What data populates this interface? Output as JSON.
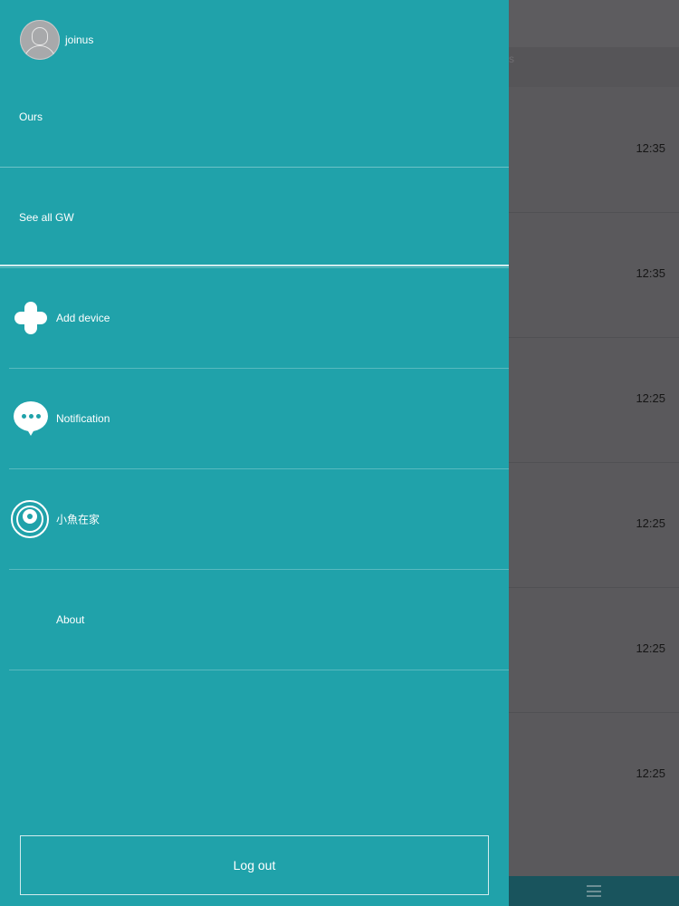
{
  "background": {
    "subbar_text": "s",
    "rows": [
      {
        "time": "12:35"
      },
      {
        "time": "12:35"
      },
      {
        "time": "12:25"
      },
      {
        "time": "12:25"
      },
      {
        "time": "12:25"
      },
      {
        "time": "12:25"
      }
    ],
    "bottom_menu_icon": "hamburger-icon"
  },
  "drawer": {
    "user": {
      "name": "joinus",
      "avatar_icon": "user-avatar-icon"
    },
    "items": [
      {
        "label": "Ours"
      },
      {
        "label": "See all GW"
      },
      {
        "label": "Add device",
        "icon": "plus-icon"
      },
      {
        "label": "Notification",
        "icon": "chat-bubble-icon"
      },
      {
        "label": "小魚在家",
        "icon": "camera-icon"
      },
      {
        "label": "About"
      }
    ],
    "logout_label": "Log out"
  },
  "colors": {
    "drawer_bg": "#20a2aa",
    "overlay_bg": "#5a595c",
    "text": "#ffffff"
  }
}
